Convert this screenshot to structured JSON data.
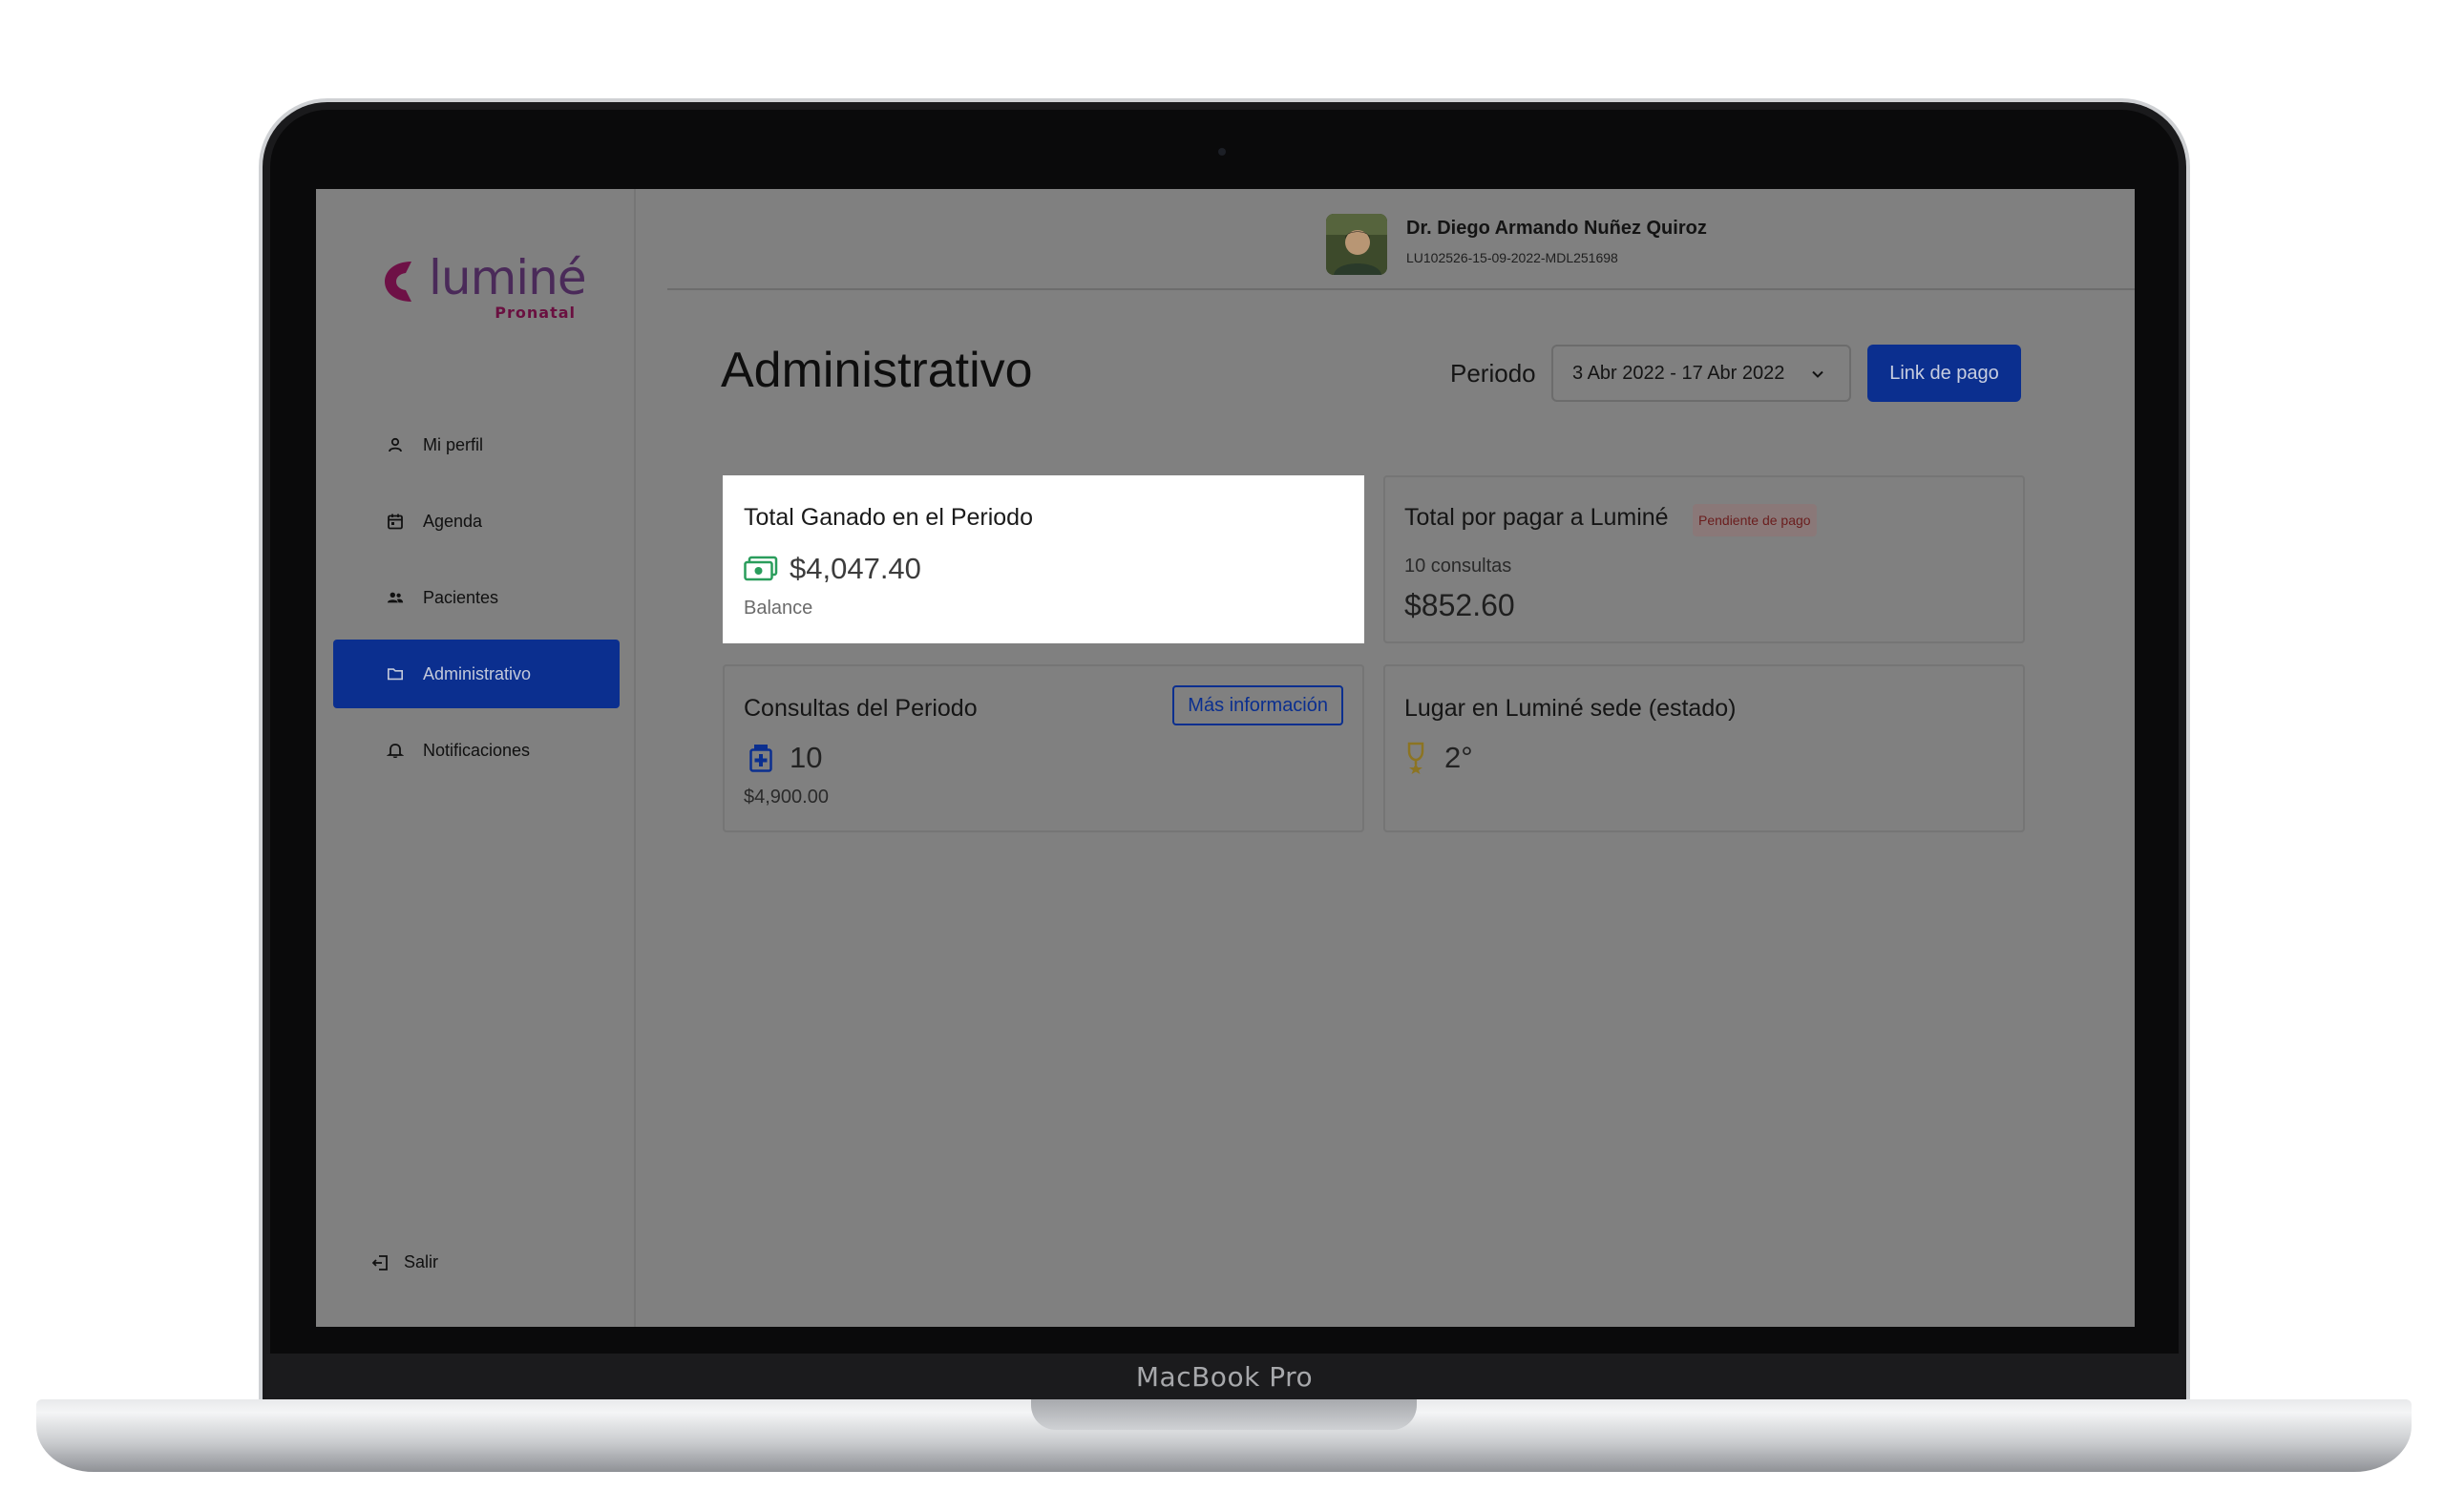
{
  "device": {
    "label": "MacBook Pro"
  },
  "brand": {
    "name": "luminé",
    "sub": "Pronatal",
    "accent": "#0b2f8f"
  },
  "sidebar": {
    "items": [
      {
        "label": "Mi perfil",
        "icon": "user-icon",
        "active": false
      },
      {
        "label": "Agenda",
        "icon": "calendar-icon",
        "active": false
      },
      {
        "label": "Pacientes",
        "icon": "users-icon",
        "active": false
      },
      {
        "label": "Administrativo",
        "icon": "folder-icon",
        "active": true
      },
      {
        "label": "Notificaciones",
        "icon": "bell-icon",
        "active": false
      }
    ],
    "logout": "Salir"
  },
  "header": {
    "user_name": "Dr. Diego Armando Nuñez Quiroz",
    "user_id": "LU102526-15-09-2022-MDL251698"
  },
  "main": {
    "title": "Administrativo",
    "period_label": "Periodo",
    "period_value": "3 Abr 2022 - 17 Abr 2022",
    "link_button": "Link de pago"
  },
  "cards": {
    "earned": {
      "title": "Total Ganado en el Periodo",
      "amount": "$4,047.40",
      "sub": "Balance"
    },
    "to_pay": {
      "title": "Total por pagar a Luminé",
      "badge": "Pendiente de pago",
      "count": "10 consultas",
      "amount": "$852.60"
    },
    "consults": {
      "title": "Consultas del Periodo",
      "button": "Más información",
      "count": "10",
      "sub": "$4,900.00"
    },
    "rank": {
      "title": "Lugar en Luminé sede (estado)",
      "value": "2°"
    }
  }
}
